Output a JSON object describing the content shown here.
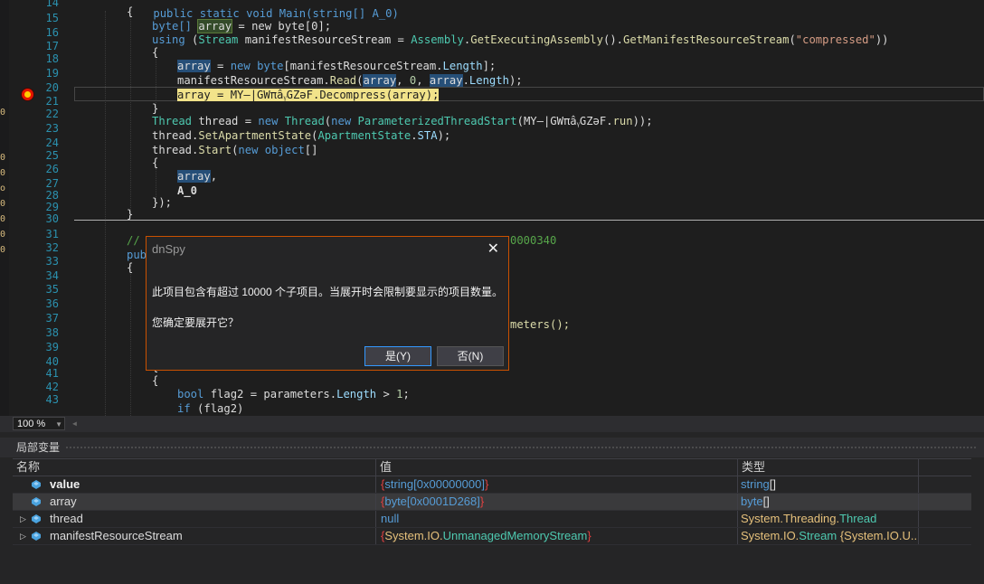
{
  "gutter": {
    "line_numbers": [
      "14",
      "15",
      "16",
      "17",
      "18",
      "19",
      "20",
      "21",
      "22",
      "23",
      "24",
      "25",
      "26",
      "27",
      "28",
      "29",
      "30",
      "31",
      "32",
      "33",
      "34",
      "35",
      "36",
      "37",
      "38",
      "39",
      "40",
      "41",
      "42",
      "43"
    ]
  },
  "left_strip": [
    "0",
    "",
    "",
    "",
    "",
    "0",
    "0",
    "o",
    "0",
    "0",
    "0",
    "0"
  ],
  "code": {
    "top_partial": "public static void Main(string[] A_0)",
    "l14": "{",
    "l15_a": "byte[] ",
    "l15_ref": "array",
    "l15_b": " = new byte[0];",
    "l16_kw": "using",
    "l16_a": " (",
    "l16_type": "Stream",
    "l16_b": " manifestResourceStream = ",
    "l16_asm": "Assembly",
    "l16_c": ".",
    "l16_m1": "GetExecutingAssembly",
    "l16_d": "().",
    "l16_m2": "GetManifestResourceStream",
    "l16_e": "(",
    "l16_str": "\"compressed\"",
    "l16_f": "))",
    "l17": "{",
    "l18_ref": "array",
    "l18_a": " = ",
    "l18_kw": "new",
    "l18_b": " ",
    "l18_type": "byte",
    "l18_c": "[manifestResourceStream.",
    "l18_prop": "Length",
    "l18_d": "];",
    "l19_a": "manifestResourceStream.",
    "l19_m": "Read",
    "l19_b": "(",
    "l19_ref1": "array",
    "l19_c": ", ",
    "l19_num": "0",
    "l19_d": ", ",
    "l19_ref2": "array",
    "l19_e": ".",
    "l19_prop": "Length",
    "l19_f": ");",
    "l20": "array = MY—|GWπâᵧGZəF.Decompress(array);",
    "l21": "}",
    "l22_type1": "Thread",
    "l22_a": " thread = ",
    "l22_kw": "new",
    "l22_b": " ",
    "l22_type2": "Thread",
    "l22_c": "(",
    "l22_kw2": "new",
    "l22_d": " ",
    "l22_type3": "ParameterizedThreadStart",
    "l22_e": "(MY—|GWπâᵧGZəF.",
    "l22_m": "run",
    "l22_f": "));",
    "l23_a": "thread.",
    "l23_m": "SetApartmentState",
    "l23_b": "(",
    "l23_type": "ApartmentState",
    "l23_c": ".",
    "l23_prop": "STA",
    "l23_d": ");",
    "l24_a": "thread.",
    "l24_m": "Start",
    "l24_b": "(",
    "l24_kw": "new",
    "l24_c": " ",
    "l24_kw2": "object",
    "l24_d": "[]",
    "l25": "{",
    "l26_ref": "array",
    "l26_a": ",",
    "l27": "A_0",
    "l28": "});",
    "l29": "}",
    "l31_cm": "//",
    "l31_tail": "0000340",
    "l32": "pub",
    "l33": "{",
    "l37_tail": "meters();",
    "l40": "{",
    "l41": "{",
    "l42_kw": "bool",
    "l42_a": " flag2 = parameters.",
    "l42_prop": "Length",
    "l42_b": " > ",
    "l42_num": "1",
    "l42_c": ";",
    "l43_kw": "if",
    "l43_a": " (flag2)"
  },
  "statusbar": {
    "zoom": "100 %"
  },
  "locals": {
    "title": "局部变量",
    "headers": {
      "name": "名称",
      "value": "值",
      "type": "类型"
    },
    "rows": [
      {
        "name": "value",
        "value_prefix": "{",
        "value_type": "string",
        "value_rest": "[0x00000000]",
        "value_suffix": "}",
        "type_a": "string",
        "type_b": "[]"
      },
      {
        "name": "array",
        "value_prefix": "{",
        "value_type": "byte",
        "value_rest": "[0x0001D268]",
        "value_suffix": "}",
        "type_a": "byte",
        "type_b": "[]"
      },
      {
        "name": "thread",
        "value": "null",
        "type_a": "System.Threading.",
        "type_b": "Thread"
      },
      {
        "name": "manifestResourceStream",
        "value_prefix": "{",
        "value_ns": "System.IO.",
        "value_type": "UnmanagedMemoryStream",
        "value_suffix": "}",
        "type_a": "System.IO.",
        "type_b": "Stream",
        "type_c": " {System.IO.U..."
      }
    ]
  },
  "dialog": {
    "title": "dnSpy",
    "close": "✕",
    "message1": "此项目包含有超过 10000 个子项目。当展开时会限制要显示的项目数量。",
    "message2": "您确定要展开它？",
    "yes": "是(Y)",
    "no": "否(N)"
  },
  "colors": {
    "accent": "#ca5100",
    "keyword": "#569cd6",
    "type": "#4ec9b0",
    "method": "#dcdcaa",
    "string": "#d69d85"
  }
}
